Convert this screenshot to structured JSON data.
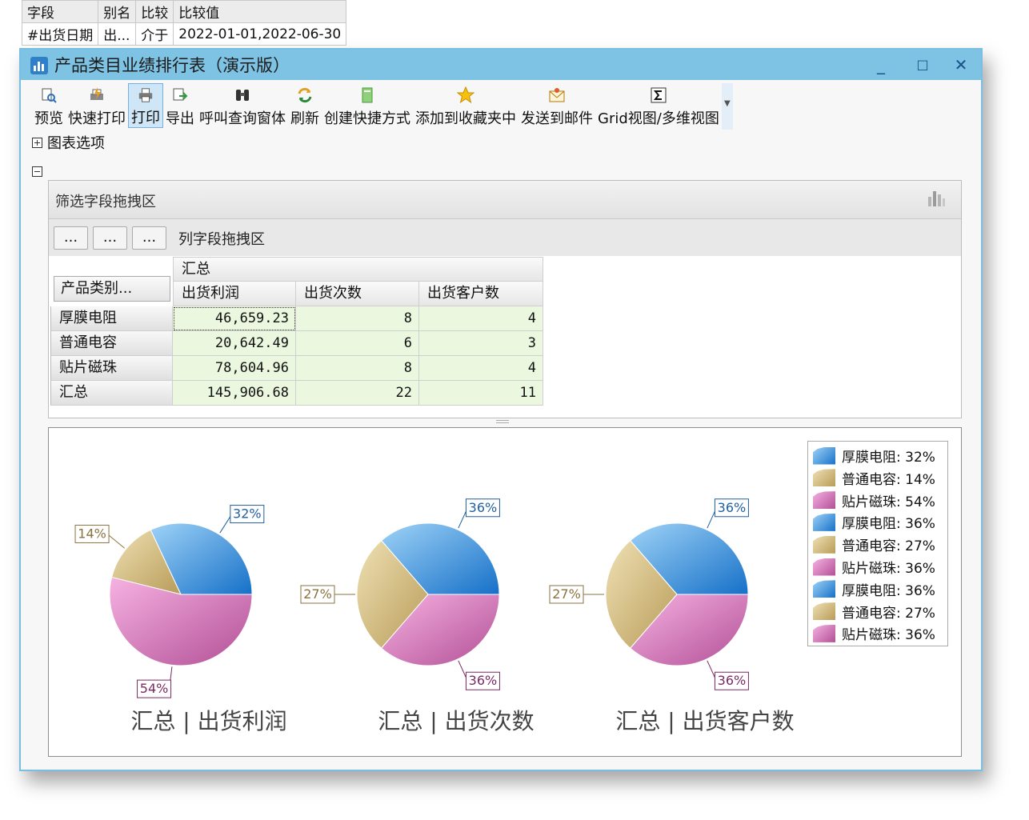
{
  "filter_table": {
    "headers": [
      "字段",
      "别名",
      "比较",
      "比较值"
    ],
    "row": [
      "#出货日期",
      "出...",
      "介于",
      "2022-01-01,2022-06-30"
    ]
  },
  "window": {
    "title": "产品类目业绩排行表（演示版）",
    "controls": {
      "minimize": "_",
      "maximize": "□",
      "close": "✕"
    }
  },
  "toolbar": {
    "items": [
      {
        "label": "预览",
        "icon": "preview-icon"
      },
      {
        "label": "快速打印",
        "icon": "quick-print-icon"
      },
      {
        "label": "打印",
        "icon": "printer-icon",
        "active": true
      },
      {
        "label": "导出",
        "icon": "export-icon"
      },
      {
        "label": "呼叫查询窗体",
        "icon": "binoculars-icon"
      },
      {
        "label": "刷新",
        "icon": "refresh-icon"
      },
      {
        "label": "创建快捷方式",
        "icon": "shortcut-icon"
      },
      {
        "label": "添加到收藏夹中",
        "icon": "star-icon"
      },
      {
        "label": "发送到邮件",
        "icon": "mail-icon"
      },
      {
        "label": "Grid视图/多维视图",
        "icon": "sigma-icon"
      }
    ]
  },
  "chart_options_label": "图表选项",
  "pivot": {
    "filter_zone_label": "筛选字段拖拽区",
    "column_zone_label": "列字段拖拽区",
    "column_zone_buttons": [
      "...",
      "...",
      "..."
    ],
    "row_field_button": "产品类别...",
    "group_header": "汇总",
    "columns": [
      "出货利润",
      "出货次数",
      "出货客户数"
    ],
    "rows": [
      {
        "label": "厚膜电阻",
        "values": [
          "46,659.23",
          "8",
          "4"
        ]
      },
      {
        "label": "普通电容",
        "values": [
          "20,642.49",
          "6",
          "3"
        ]
      },
      {
        "label": "贴片磁珠",
        "values": [
          "78,604.96",
          "8",
          "4"
        ]
      },
      {
        "label": "汇总",
        "values": [
          "145,906.68",
          "22",
          "11"
        ]
      }
    ]
  },
  "colors": {
    "blue": "#2e8de0",
    "tan": "#c9b078",
    "pink": "#d878b8",
    "title_bar": "#7ec3e3",
    "data_cell": "#ebf7df"
  },
  "chart_data": [
    {
      "type": "pie",
      "title": "汇总 | 出货利润",
      "categories": [
        "厚膜电阻",
        "普通电容",
        "贴片磁珠"
      ],
      "values": [
        46659.23,
        20642.49,
        78604.96
      ],
      "labels": [
        "32%",
        "14%",
        "54%"
      ]
    },
    {
      "type": "pie",
      "title": "汇总 | 出货次数",
      "categories": [
        "厚膜电阻",
        "普通电容",
        "贴片磁珠"
      ],
      "values": [
        8,
        6,
        8
      ],
      "labels": [
        "36%",
        "27%",
        "36%"
      ]
    },
    {
      "type": "pie",
      "title": "汇总 | 出货客户数",
      "categories": [
        "厚膜电阻",
        "普通电容",
        "贴片磁珠"
      ],
      "values": [
        4,
        3,
        4
      ],
      "labels": [
        "36%",
        "27%",
        "36%"
      ]
    }
  ],
  "legend": {
    "placement": "top-right",
    "items": [
      {
        "text": "厚膜电阻: 32%",
        "series": "blue"
      },
      {
        "text": "普通电容: 14%",
        "series": "tan"
      },
      {
        "text": "贴片磁珠: 54%",
        "series": "pink"
      },
      {
        "text": "厚膜电阻: 36%",
        "series": "blue"
      },
      {
        "text": "普通电容: 27%",
        "series": "tan"
      },
      {
        "text": "贴片磁珠: 36%",
        "series": "pink"
      },
      {
        "text": "厚膜电阻: 36%",
        "series": "blue"
      },
      {
        "text": "普通电容: 27%",
        "series": "tan"
      },
      {
        "text": "贴片磁珠: 36%",
        "series": "pink"
      }
    ]
  }
}
